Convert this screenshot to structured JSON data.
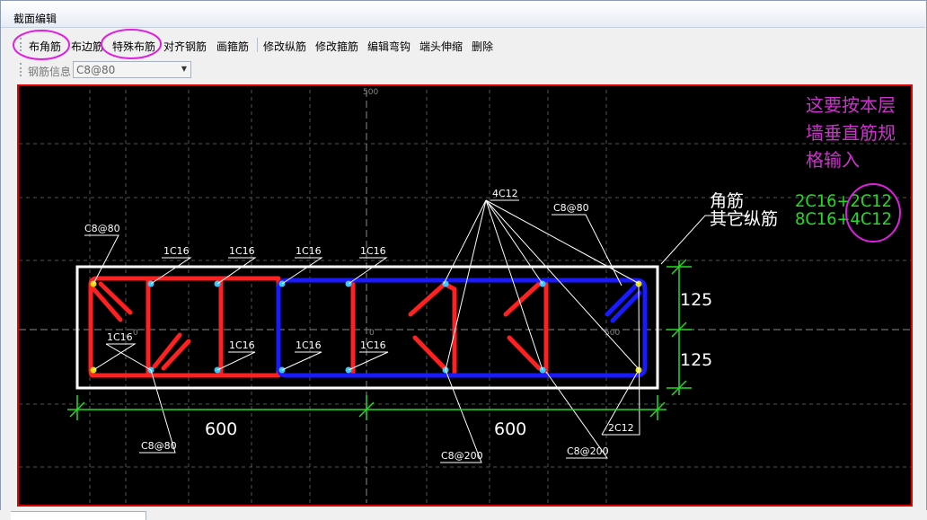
{
  "window": {
    "title": "截面编辑"
  },
  "toolbar": {
    "items": [
      "布角筋",
      "布边筋",
      "特殊布筋",
      "对齐钢筋",
      "画箍筋",
      "修改纵筋",
      "修改箍筋",
      "编辑弯钩",
      "端头伸缩",
      "删除"
    ]
  },
  "info": {
    "label": "钢筋信息",
    "value": "C8@80"
  },
  "drawing": {
    "note_lines": [
      "这要按本层",
      "墙垂直筋规",
      "格输入"
    ],
    "corner_label": "角筋",
    "corner_value": "2C16+2C12",
    "other_label": "其它纵筋",
    "other_value": "8C16+4C12",
    "top_tick": "500",
    "mid_tick": "500",
    "center_tick": "0",
    "left_tick": "0",
    "dim_right_top": "125",
    "dim_right_bottom": "125",
    "dim_bottom_left": "600",
    "dim_bottom_right": "600",
    "labels": {
      "c8_80_top": "C8@80",
      "c16_1": "1C16",
      "c16_2": "1C16",
      "c16_3": "1C16",
      "c16_4": "1C16",
      "c16_left": "1C16",
      "c16_5": "1C16",
      "c16_6": "1C16",
      "c16_7": "1C16",
      "c12_4": "4C12",
      "c8_80_right": "C8@80",
      "c8_80_bottom": "C8@80",
      "c8_200_a": "C8@200",
      "c8_200_b": "C8@200",
      "c12_2": "2C12"
    }
  },
  "colors": {
    "annotation": "#cc33cc",
    "green": "#22dd22",
    "red_bar": "#ff2020",
    "blue_bar": "#1a1aff",
    "section_outline": "#ffffff"
  }
}
